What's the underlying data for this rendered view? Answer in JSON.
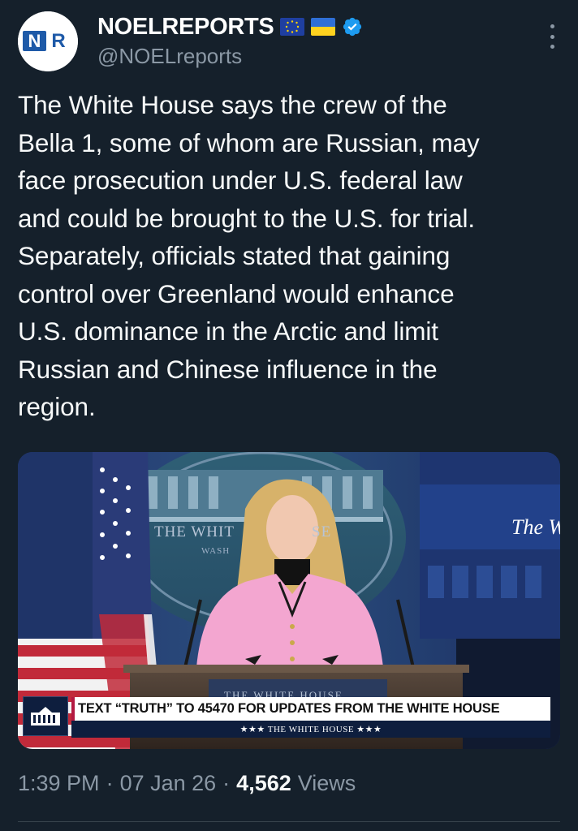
{
  "author": {
    "display_name": "NOELREPORTS",
    "handle": "@NOELreports",
    "avatar_text": "NR",
    "flags": [
      "eu-flag-icon",
      "ukraine-flag-icon"
    ],
    "verified": true
  },
  "tweet": {
    "text": "The White House says the crew of the\nBella 1, some of whom are Russian, may\nface prosecution under U.S. federal law\nand could be brought to the U.S. for trial.\nSeparately, officials stated that gaining\ncontrol over Greenland would enhance\nU.S. dominance in the Arctic and limit\nRussian and Chinese influence in the\nregion."
  },
  "media": {
    "seal_text_left": "THE WHIT",
    "seal_text_right": "SE",
    "seal_subtext": "WASH",
    "wall_text": "The W",
    "podium_text": "THE WHITE HOUSE",
    "ticker_text": "TEXT “TRUTH” TO 45470 FOR UPDATES FROM THE WHITE HOUSE",
    "ticker_subtext": "★★★  THE WHITE HOUSE  ★★★"
  },
  "meta": {
    "time": "1:39 PM",
    "date": "07 Jan 26",
    "views_count": "4,562",
    "views_label": "Views"
  },
  "colors": {
    "background": "#15202b",
    "secondary_text": "#8b98a5",
    "verified": "#1d9bf0",
    "divider": "#38444d"
  }
}
